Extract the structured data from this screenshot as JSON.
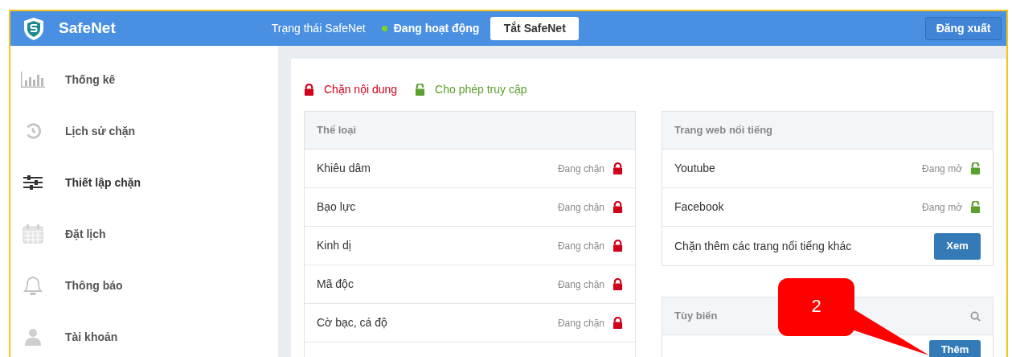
{
  "header": {
    "brand": "SafeNet",
    "status_label": "Trạng thái SafeNet",
    "status_value": "Đang hoạt động",
    "active": true,
    "toggle_button": "Tắt SafeNet",
    "logout_button": "Đăng xuất"
  },
  "sidebar": {
    "items": [
      {
        "kind": "stats",
        "label": "Thống kê",
        "selected": false
      },
      {
        "kind": "history",
        "label": "Lịch sử chặn",
        "selected": false
      },
      {
        "kind": "settings",
        "label": "Thiết lập chặn",
        "selected": true
      },
      {
        "kind": "schedule",
        "label": "Đặt lịch",
        "selected": false
      },
      {
        "kind": "notifications",
        "label": "Thông báo",
        "selected": false
      },
      {
        "kind": "account",
        "label": "Tài khoản",
        "selected": false
      }
    ]
  },
  "legend": [
    {
      "blocked": true,
      "label": "Chặn nội dung"
    },
    {
      "blocked": false,
      "label": "Cho phép truy cập"
    }
  ],
  "categories": {
    "title": "Thể loại",
    "rows": [
      {
        "name": "Khiêu dâm",
        "status": "Đang chặn",
        "blocked": true
      },
      {
        "name": "Bạo lực",
        "status": "Đang chặn",
        "blocked": true
      },
      {
        "name": "Kinh dị",
        "status": "Đang chặn",
        "blocked": true
      },
      {
        "name": "Mã độc",
        "status": "Đang chặn",
        "blocked": true
      },
      {
        "name": "Cờ bạc, cá độ",
        "status": "Đang chặn",
        "blocked": true
      }
    ]
  },
  "popular_sites": {
    "title": "Trang web nổi tiếng",
    "rows": [
      {
        "name": "Youtube",
        "status": "Đang mở",
        "blocked": false
      },
      {
        "name": "Facebook",
        "status": "Đang mở",
        "blocked": false
      }
    ],
    "more_text": "Chặn thêm các trang nổi tiếng khác",
    "more_button": "Xem"
  },
  "custom": {
    "title": "Tùy biến",
    "add_button": "Thêm"
  },
  "callout": {
    "label": "2"
  }
}
